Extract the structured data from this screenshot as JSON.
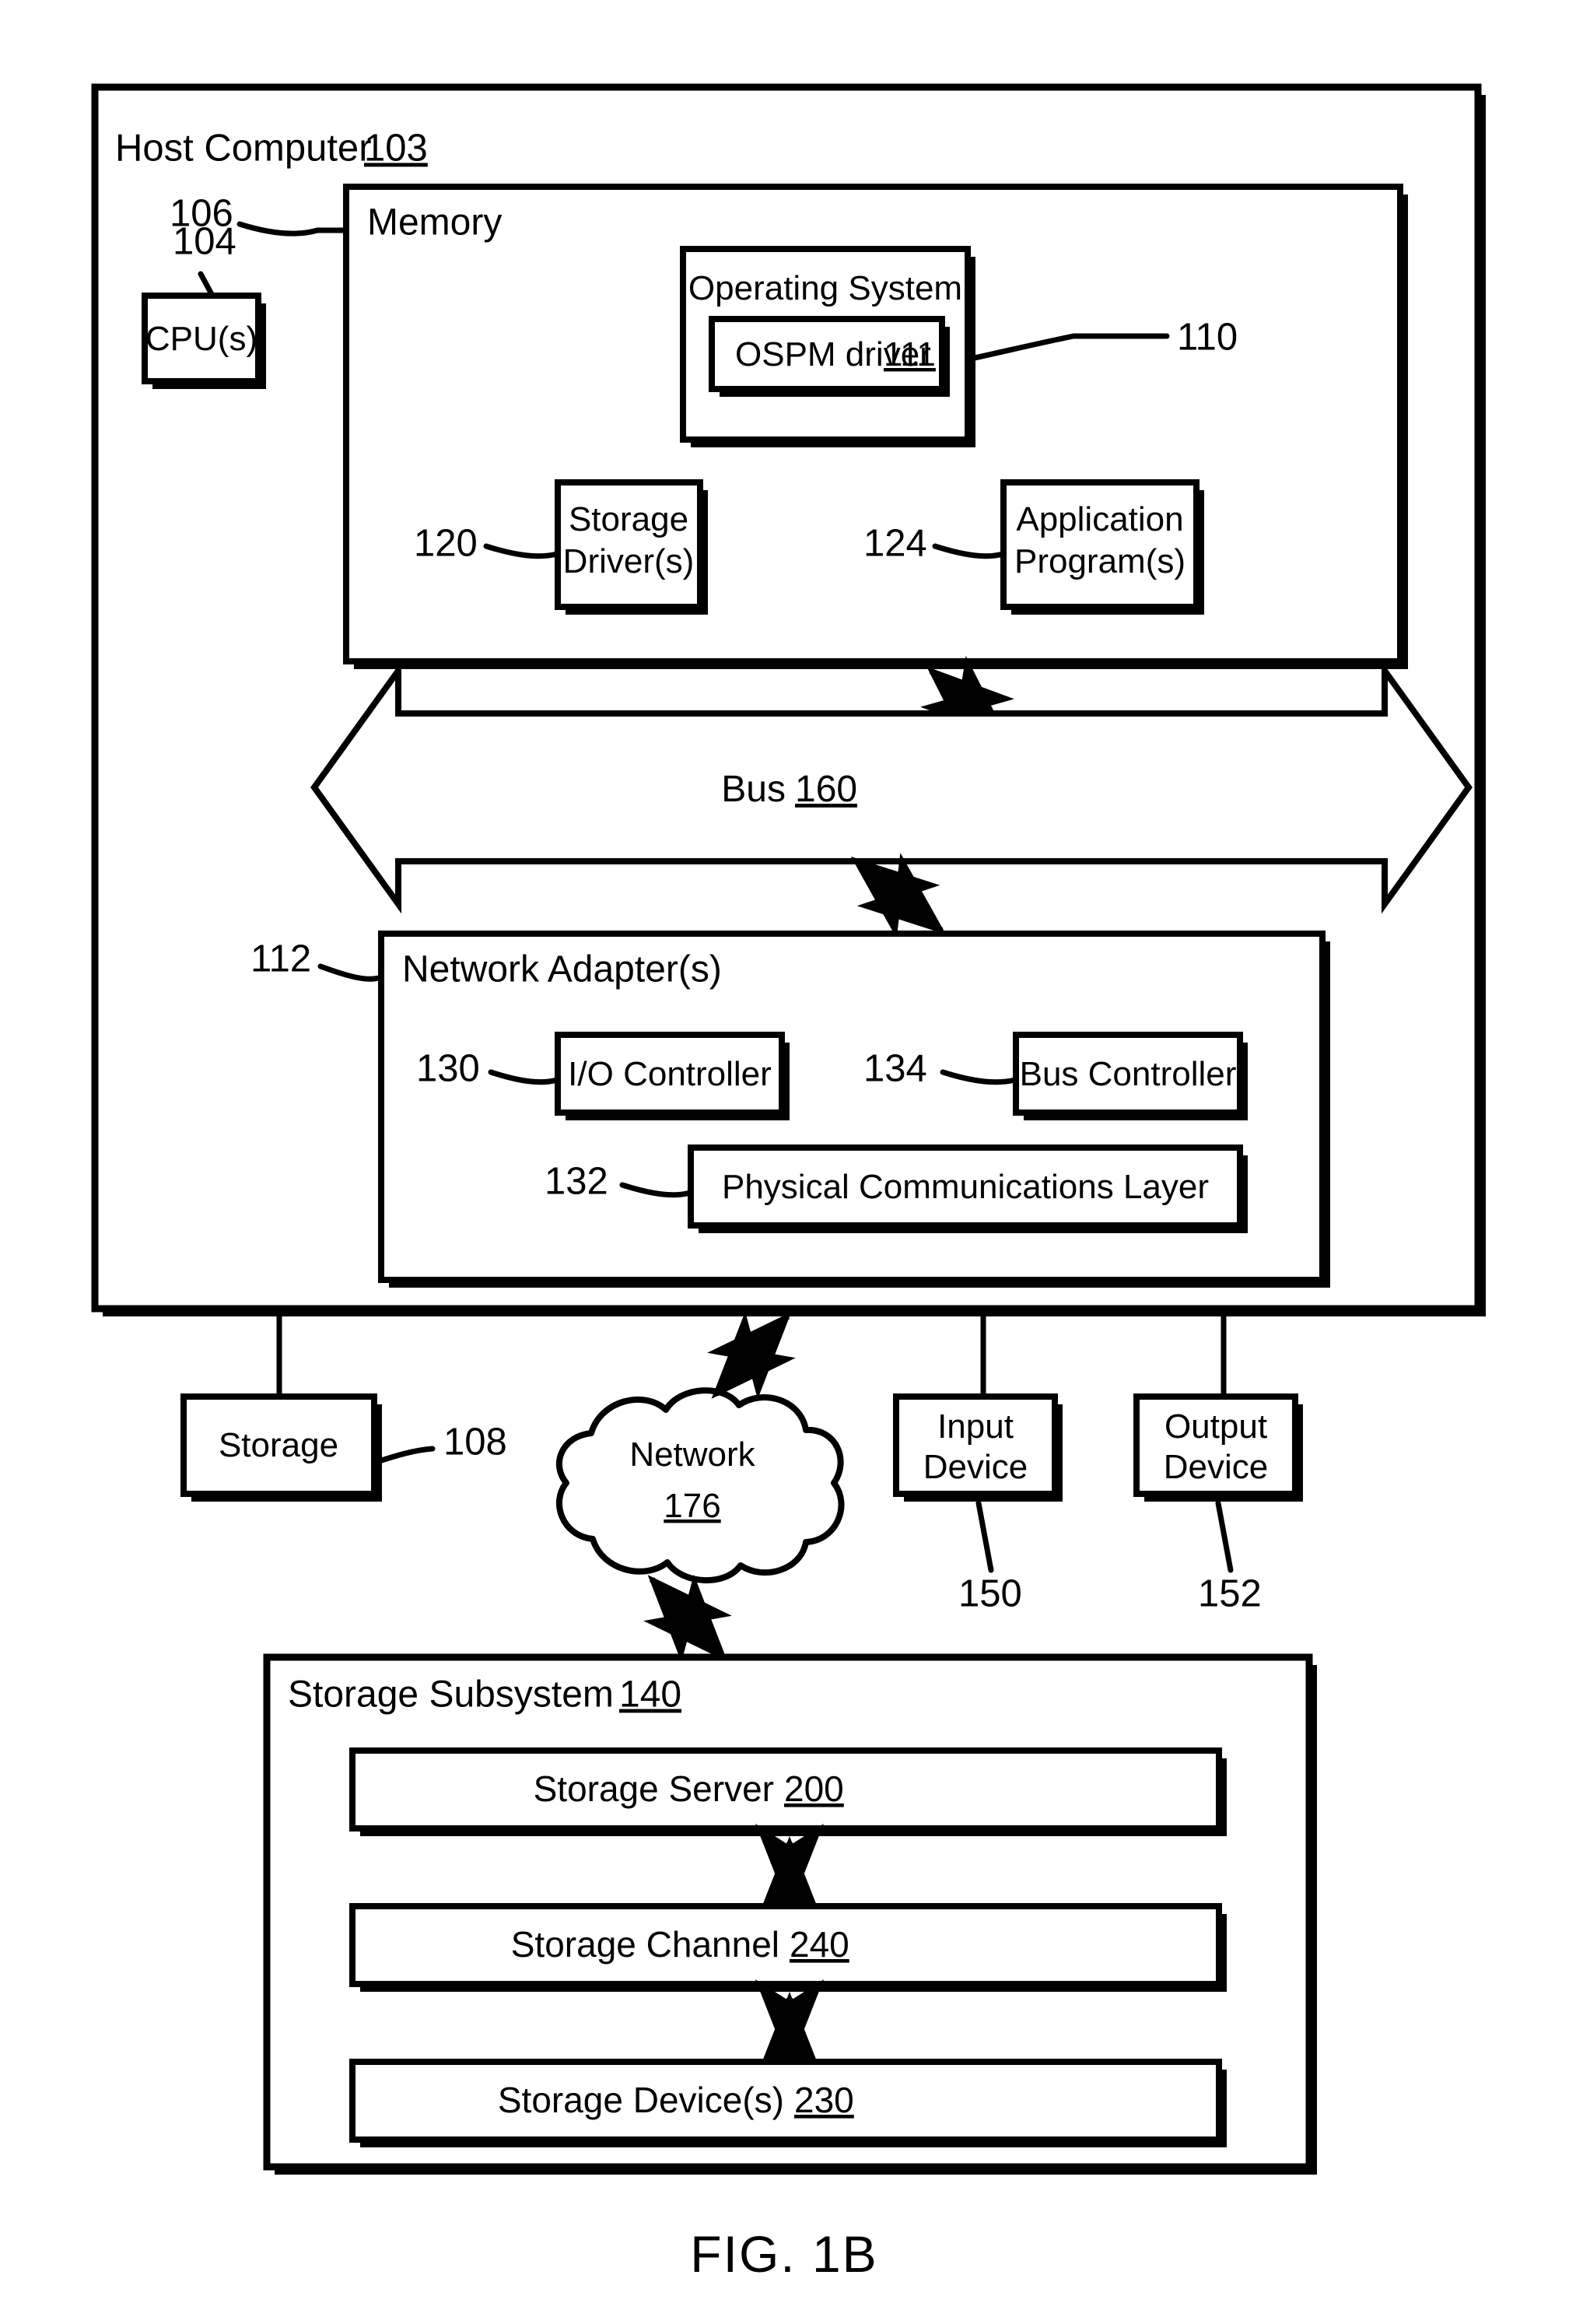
{
  "figure": {
    "caption": "FIG. 1B"
  },
  "host_computer": {
    "title": "Host Computer",
    "ref": "103"
  },
  "cpu": {
    "label": "CPU(s)",
    "ref": "104"
  },
  "memory": {
    "title": "Memory",
    "ref": "106",
    "operating_system": {
      "label": "Operating System",
      "ref": "110",
      "ospm_driver": {
        "label": "OSPM driver",
        "ref": "111"
      }
    },
    "storage_driver": {
      "label_line1": "Storage",
      "label_line2": "Driver(s)",
      "ref": "120"
    },
    "application_program": {
      "label_line1": "Application",
      "label_line2": "Program(s)",
      "ref": "124"
    }
  },
  "bus": {
    "label": "Bus",
    "ref": "160"
  },
  "network_adapter": {
    "title": "Network Adapter(s)",
    "ref": "112",
    "io_controller": {
      "label": "I/O Controller",
      "ref": "130"
    },
    "bus_controller": {
      "label": "Bus Controller",
      "ref": "134"
    },
    "physical_comm_layer": {
      "label": "Physical Communications Layer",
      "ref": "132"
    }
  },
  "peripherals": {
    "storage": {
      "label": "Storage",
      "ref": "108"
    },
    "network": {
      "label": "Network",
      "ref": "176"
    },
    "input_device": {
      "label_line1": "Input",
      "label_line2": "Device",
      "ref": "150"
    },
    "output_device": {
      "label_line1": "Output",
      "label_line2": "Device",
      "ref": "152"
    }
  },
  "storage_subsystem": {
    "title": "Storage Subsystem",
    "ref": "140",
    "storage_server": {
      "label": "Storage Server",
      "ref": "200"
    },
    "storage_channel": {
      "label": "Storage Channel",
      "ref": "240"
    },
    "storage_devices": {
      "label": "Storage Device(s)",
      "ref": "230"
    }
  },
  "style": {
    "line_color": "#000000",
    "background": "#ffffff"
  }
}
